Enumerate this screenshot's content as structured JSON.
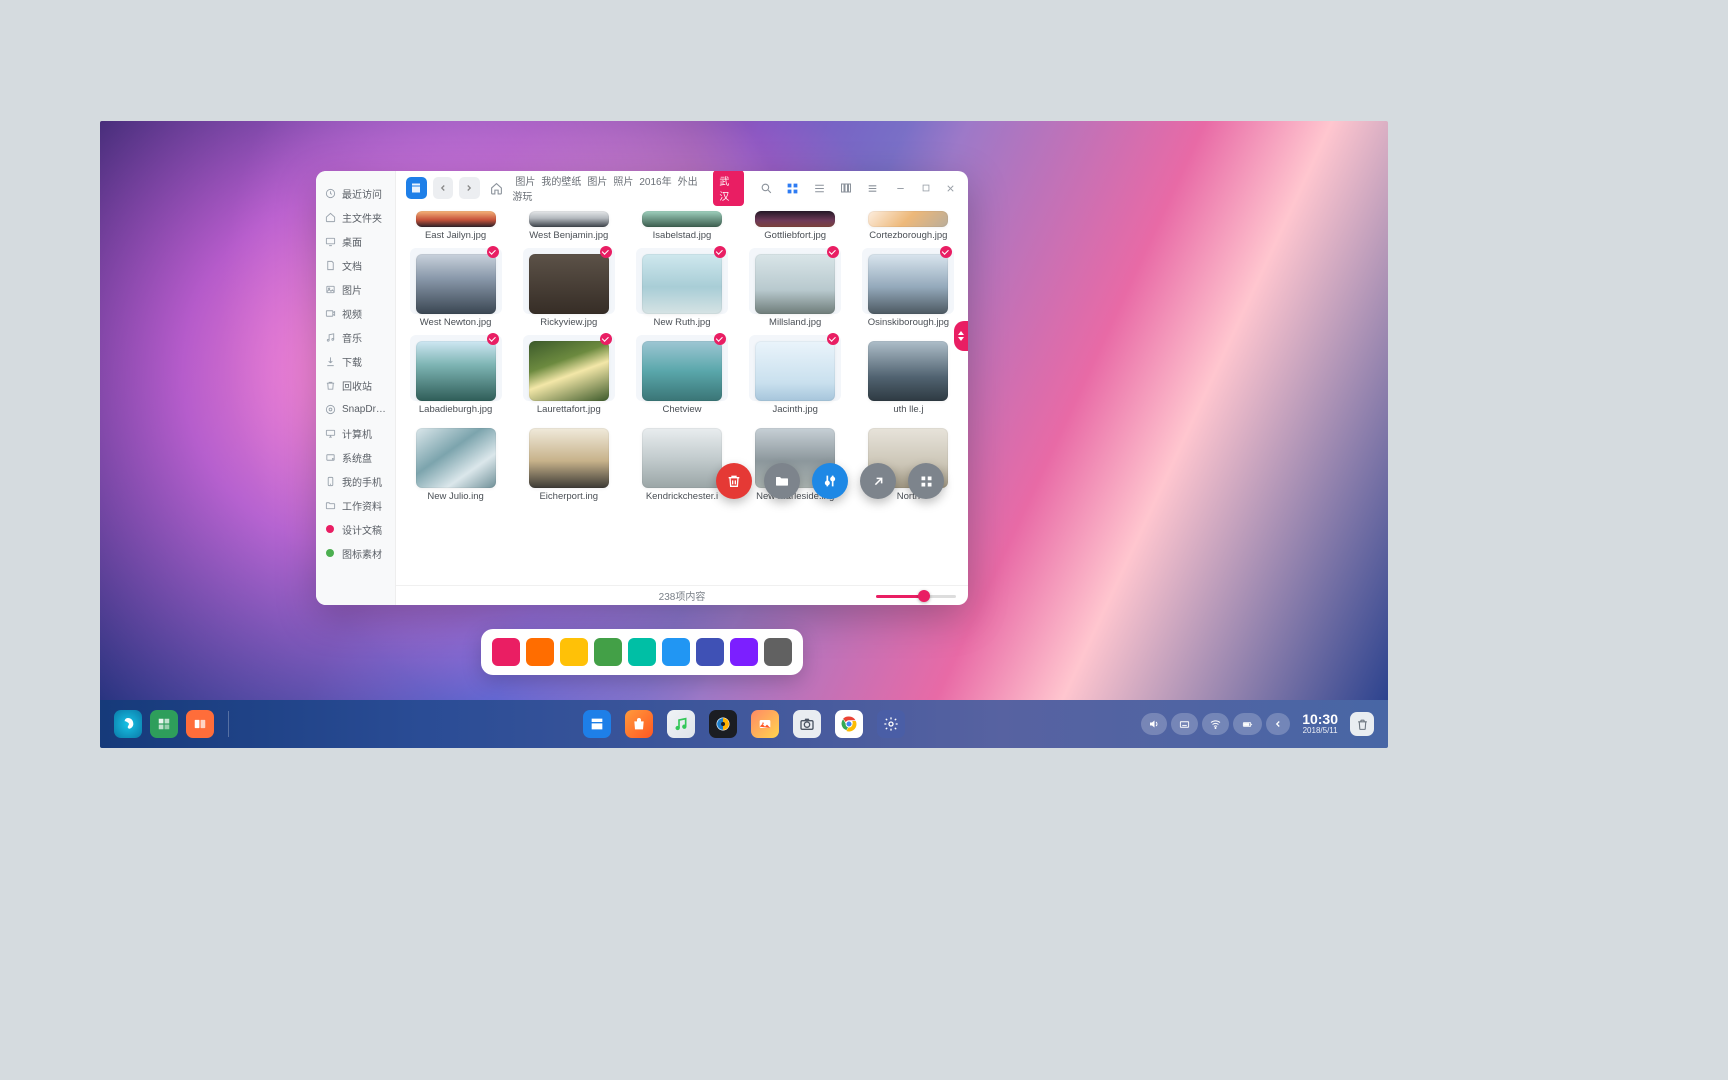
{
  "colors": {
    "accent_pink": "#e91e63",
    "accent_blue": "#1e88e5"
  },
  "sidebar": [
    {
      "icon": "clock",
      "label": "最近访问"
    },
    {
      "icon": "home",
      "label": "主文件夹"
    },
    {
      "icon": "desktop",
      "label": "桌面"
    },
    {
      "icon": "doc",
      "label": "文档"
    },
    {
      "icon": "image",
      "label": "图片"
    },
    {
      "icon": "video",
      "label": "视频"
    },
    {
      "icon": "music",
      "label": "音乐"
    },
    {
      "icon": "download",
      "label": "下载"
    },
    {
      "icon": "trash",
      "label": "回收站"
    },
    {
      "icon": "snap",
      "label": "SnapDrop"
    },
    {
      "icon": "computer",
      "label": "计算机"
    },
    {
      "icon": "disk",
      "label": "系统盘"
    },
    {
      "icon": "phone",
      "label": "我的手机"
    },
    {
      "icon": "folder",
      "label": "工作资料"
    },
    {
      "icon": "dot-pink",
      "label": "设计文稿",
      "cls": "pink"
    },
    {
      "icon": "dot-green",
      "label": "图标素材",
      "cls": "green"
    }
  ],
  "breadcrumbs": [
    "图片",
    "我的壁纸",
    "图片",
    "照片",
    "2016年",
    "外出游玩"
  ],
  "breadcrumb_active": "武汉",
  "files": {
    "row0": [
      {
        "name": "East Jailyn.jpg",
        "thumb": "sunset"
      },
      {
        "name": "West Benjamin.jpg",
        "thumb": "city"
      },
      {
        "name": "Isabelstad.jpg",
        "thumb": "field"
      },
      {
        "name": "Gottliebfort.jpg",
        "thumb": "dark"
      },
      {
        "name": "Cortezborough.jpg",
        "thumb": "paint"
      }
    ],
    "row1": [
      {
        "name": "West Newton.jpg",
        "sel": true,
        "thumb": "sea-dusk"
      },
      {
        "name": "Rickyview.jpg",
        "sel": true,
        "thumb": "abandoned"
      },
      {
        "name": "New Ruth.jpg",
        "sel": true,
        "thumb": "beach-chair"
      },
      {
        "name": "Millsland.jpg",
        "sel": true,
        "thumb": "shell"
      },
      {
        "name": "Osinskiborough.jpg",
        "sel": true,
        "thumb": "cliff"
      }
    ],
    "row2": [
      {
        "name": "Labadieburgh.jpg",
        "sel": true,
        "thumb": "palm"
      },
      {
        "name": "Laurettafort.jpg",
        "sel": true,
        "thumb": "forest-sun"
      },
      {
        "name": "Chetview",
        "sel": true,
        "thumb": "aqua-rock"
      },
      {
        "name": "Jacinth.jpg",
        "sel": true,
        "thumb": "pale-sky"
      },
      {
        "name": "uth lle.j",
        "thumb": "rocky-coast"
      }
    ],
    "row3": [
      {
        "name": "New Julio.ing",
        "thumb": "waves"
      },
      {
        "name": "Eicherport.ing",
        "thumb": "dune-sun"
      },
      {
        "name": "Kendrickchester.i",
        "thumb": "fog-beach"
      },
      {
        "name": "New Marleside.ing",
        "thumb": "horizon"
      },
      {
        "name": "North",
        "thumb": "lone"
      }
    ]
  },
  "status_text": "238项内容",
  "float_actions": [
    {
      "name": "delete",
      "color": "red",
      "icon": "trash"
    },
    {
      "name": "open-folder",
      "color": "gray",
      "icon": "folder"
    },
    {
      "name": "adjust",
      "color": "blue",
      "icon": "sliders"
    },
    {
      "name": "open-external",
      "color": "gray",
      "icon": "external"
    },
    {
      "name": "grid-view",
      "color": "gray",
      "icon": "grid"
    }
  ],
  "palette": [
    "#ea1e63",
    "#ff6d00",
    "#ffc107",
    "#43a047",
    "#00bfa5",
    "#2196f3",
    "#3f51b5",
    "#7c1fff",
    "#616161"
  ],
  "dock": [
    {
      "name": "store",
      "bg": "#1e7fe8"
    },
    {
      "name": "shop",
      "bg": "linear-gradient(135deg,#ff9a3c,#ff5722)"
    },
    {
      "name": "music",
      "bg": "linear-gradient(135deg,#f0f3f6,#dfe4ea)",
      "fg": "#34c759"
    },
    {
      "name": "media-player",
      "bg": "#1b1d22"
    },
    {
      "name": "photos",
      "bg": "linear-gradient(135deg,#ff8a65,#ffd54f)"
    },
    {
      "name": "camera",
      "bg": "#e9edf1",
      "fg": "#4b5563"
    },
    {
      "name": "browser-chrome",
      "bg": "#ffffff"
    },
    {
      "name": "settings",
      "bg": "#4a5ea6",
      "fg": "#fff"
    }
  ],
  "tray": [
    "volume",
    "keyboard",
    "wifi",
    "battery",
    "chevron-left"
  ],
  "clock": {
    "time": "10:30",
    "date": "2018/5/11"
  }
}
